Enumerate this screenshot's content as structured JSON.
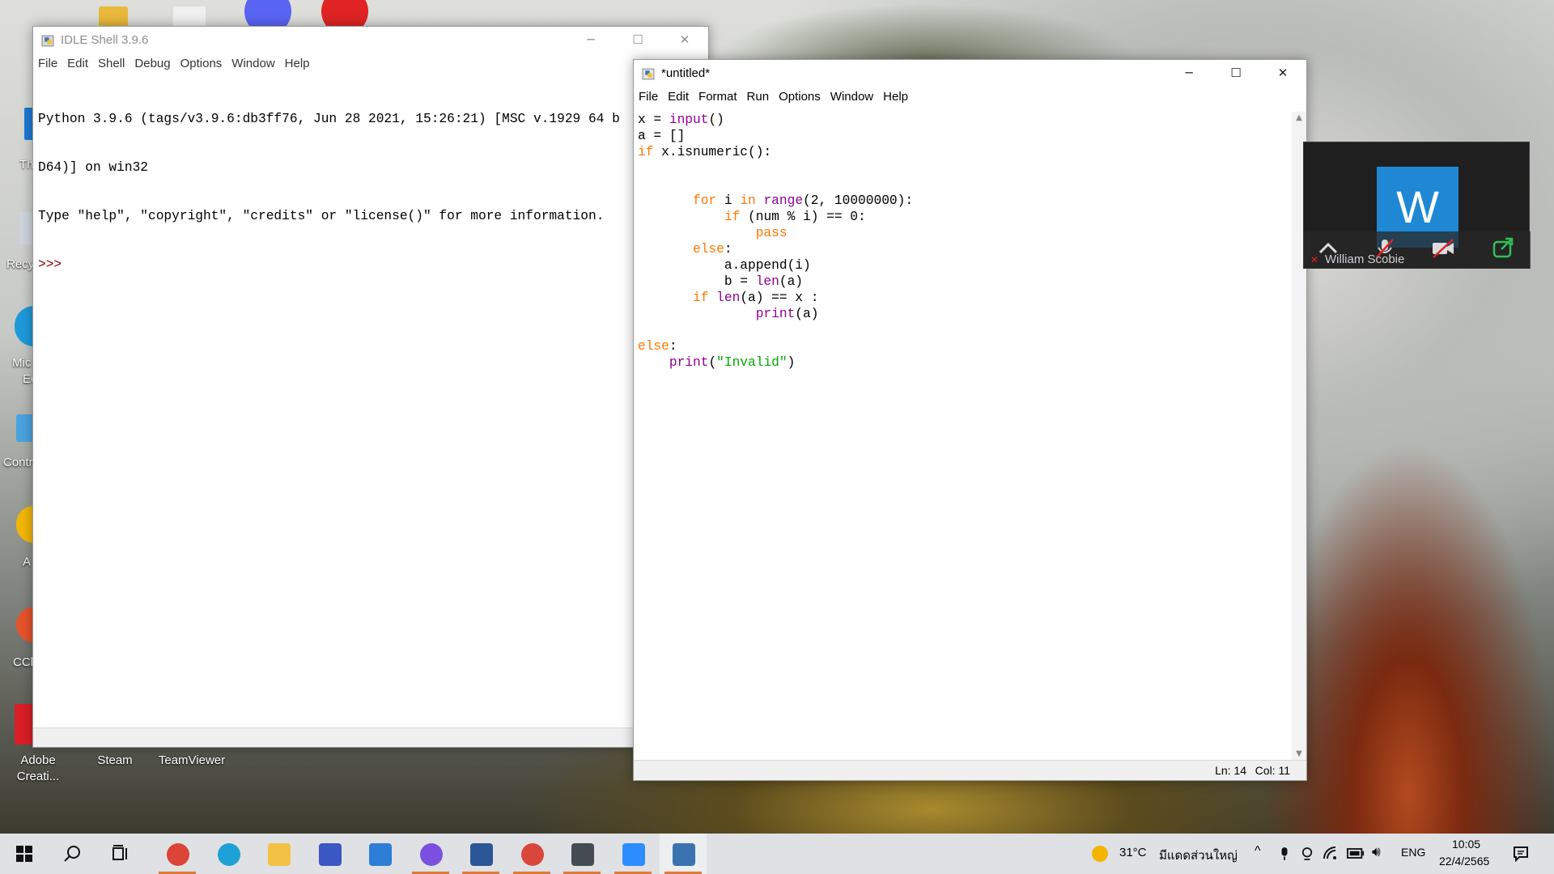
{
  "desktop": {
    "icons": [
      {
        "label": "Adobe Creati..."
      },
      {
        "label": "Steam"
      },
      {
        "label": "TeamViewer"
      }
    ],
    "partial_labels": [
      "Th",
      "Recy",
      "Mic",
      "Ec",
      "Contr",
      "A",
      "CCl"
    ]
  },
  "shell": {
    "title": "IDLE Shell 3.9.6",
    "menu": [
      "File",
      "Edit",
      "Shell",
      "Debug",
      "Options",
      "Window",
      "Help"
    ],
    "lines": [
      "Python 3.9.6 (tags/v3.9.6:db3ff76, Jun 28 2021, 15:26:21) [MSC v.1929 64 b",
      "D64)] on win32",
      "Type \"help\", \"copyright\", \"credits\" or \"license()\" for more information."
    ],
    "prompt": ">>>"
  },
  "editor": {
    "title": "*untitled*",
    "menu": [
      "File",
      "Edit",
      "Format",
      "Run",
      "Options",
      "Window",
      "Help"
    ],
    "code": [
      [
        [
          "",
          "x = "
        ],
        [
          "bi",
          "input"
        ],
        [
          "",
          "()"
        ]
      ],
      [
        [
          "",
          "a = []"
        ]
      ],
      [
        [
          "kw",
          "if"
        ],
        [
          "",
          " x.isnumeric():"
        ]
      ],
      [],
      [],
      [
        [
          "",
          "       "
        ],
        [
          "kw",
          "for"
        ],
        [
          "",
          " i "
        ],
        [
          "kw",
          "in"
        ],
        [
          "",
          " "
        ],
        [
          "bi",
          "range"
        ],
        [
          "",
          "(2, 10000000):"
        ]
      ],
      [
        [
          "",
          "           "
        ],
        [
          "kw",
          "if"
        ],
        [
          "",
          " (num % i) == 0:"
        ]
      ],
      [
        [
          "",
          "               "
        ],
        [
          "kw",
          "pass"
        ]
      ],
      [
        [
          "",
          "       "
        ],
        [
          "kw",
          "else"
        ],
        [
          "",
          ":"
        ]
      ],
      [
        [
          "",
          "           a.append(i)"
        ]
      ],
      [
        [
          "",
          "           b = "
        ],
        [
          "bi",
          "len"
        ],
        [
          "",
          "(a)"
        ]
      ],
      [
        [
          "",
          "       "
        ],
        [
          "kw",
          "if"
        ],
        [
          "",
          " "
        ],
        [
          "bi",
          "len"
        ],
        [
          "",
          "(a) == x :"
        ]
      ],
      [
        [
          "",
          "               "
        ],
        [
          "bi",
          "print"
        ],
        [
          "",
          "(a)"
        ]
      ],
      [],
      [
        [
          "kw",
          "else"
        ],
        [
          "",
          ":"
        ]
      ],
      [
        [
          "",
          "    "
        ],
        [
          "bi",
          "print"
        ],
        [
          "",
          "("
        ],
        [
          "str",
          "\"Invalid\""
        ],
        [
          "",
          ")"
        ]
      ]
    ],
    "status": {
      "line": "Ln: 14",
      "col": "Col: 11"
    }
  },
  "zoom": {
    "initial": "W",
    "participant": "William Scobie"
  },
  "taskbar": {
    "apps": [
      {
        "name": "chrome-icon",
        "color": "#db4437",
        "active": true
      },
      {
        "name": "edge-icon",
        "color": "#1da1d6",
        "active": false
      },
      {
        "name": "file-explorer-icon",
        "color": "#f3c244",
        "active": false
      },
      {
        "name": "app-blue-icon",
        "color": "#3b57c4",
        "active": false
      },
      {
        "name": "mail-icon",
        "color": "#2e7dd6",
        "active": false
      },
      {
        "name": "messenger-icon",
        "color": "#7b4fe0",
        "active": true
      },
      {
        "name": "word-icon",
        "color": "#2b5797",
        "active": true
      },
      {
        "name": "chrome-profile-icon",
        "color": "#d9473b",
        "active": true
      },
      {
        "name": "unity-icon",
        "color": "#444b52",
        "active": true
      },
      {
        "name": "zoom-icon",
        "color": "#2d8cff",
        "active": true
      },
      {
        "name": "python-idle-icon",
        "color": "#3a73b0",
        "active": true
      }
    ],
    "weather": {
      "temp": "31°C",
      "desc": "มีแดดส่วนใหญ่"
    },
    "lang": "ENG",
    "time": "10:05",
    "date": "22/4/2565"
  }
}
